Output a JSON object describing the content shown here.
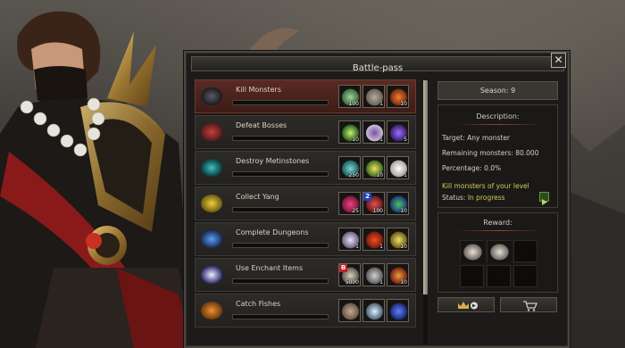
{
  "window": {
    "title": "Battle-pass",
    "close_label": "✕"
  },
  "tasks": [
    {
      "name": "Kill Monsters",
      "active": true,
      "progress": 0.0,
      "rewards": [
        {
          "icon": "green-chest-icon",
          "qty": "100"
        },
        {
          "icon": "stone-icon",
          "qty": "1"
        },
        {
          "icon": "red-orb-icon",
          "qty": "10"
        }
      ]
    },
    {
      "name": "Defeat Bosses",
      "active": false,
      "progress": 0.0,
      "rewards": [
        {
          "icon": "green-crystal-icon",
          "qty": "10"
        },
        {
          "icon": "scroll-icon",
          "qty": "1"
        },
        {
          "icon": "purple-gem-icon",
          "qty": "5"
        }
      ]
    },
    {
      "name": "Destroy Metinstones",
      "active": false,
      "progress": 0.0,
      "rewards": [
        {
          "icon": "teal-chest-icon",
          "qty": "250"
        },
        {
          "icon": "green-potion-icon",
          "qty": "10"
        },
        {
          "icon": "white-sack-icon",
          "qty": "1"
        }
      ]
    },
    {
      "name": "Collect Yang",
      "active": false,
      "progress": 0.0,
      "rewards": [
        {
          "icon": "red-scroll-icon",
          "qty": "25"
        },
        {
          "icon": "red-chest-icon",
          "qty": "100",
          "badge": "2"
        },
        {
          "icon": "blue-potion-icon",
          "qty": "10"
        }
      ]
    },
    {
      "name": "Complete Dungeons",
      "active": false,
      "progress": 0.0,
      "rewards": [
        {
          "icon": "lollipop-icon",
          "qty": "1"
        },
        {
          "icon": "feather-icon",
          "qty": "1"
        },
        {
          "icon": "gold-gem-icon",
          "qty": "10"
        }
      ]
    },
    {
      "name": "Use Enchant Items",
      "active": false,
      "progress": 0.0,
      "rewards": [
        {
          "icon": "armor-icon",
          "qty": "5000",
          "badge": "B"
        },
        {
          "icon": "silver-ore-icon",
          "qty": "1"
        },
        {
          "icon": "red-book-icon",
          "qty": "10"
        }
      ]
    },
    {
      "name": "Catch Fishes",
      "active": false,
      "progress": 0.0,
      "rewards": [
        {
          "icon": "rock-icon",
          "qty": ""
        },
        {
          "icon": "pearl-icon",
          "qty": ""
        },
        {
          "icon": "blue-book-icon",
          "qty": ""
        }
      ]
    }
  ],
  "season": {
    "label": "Season: 9"
  },
  "description": {
    "heading": "Description:",
    "target": "Target: Any monster",
    "remaining": "Remaining monsters: 80.000",
    "percentage": "Percentage: 0.0%",
    "goal": "Kill monsters of your level",
    "status_label": "Status:",
    "status_value": "In progress"
  },
  "reward_panel": {
    "heading": "Reward:",
    "items": [
      "armor-set-icon",
      "armor-set-icon",
      "",
      "",
      "",
      ""
    ]
  },
  "buttons": {
    "left_icon": "crown-arrow-icon",
    "right_icon": "shopping-cart-icon"
  },
  "colors": {
    "active_row": "#5a2a22",
    "highlight_text": "#d9c85a",
    "accent_red": "#a04030"
  }
}
